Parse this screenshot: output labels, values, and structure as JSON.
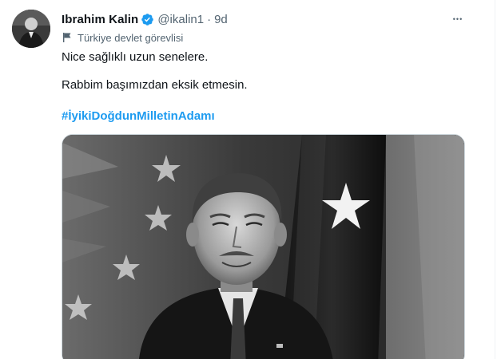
{
  "tweet": {
    "author_name": "Ibrahim Kalin",
    "verified_icon": "verified-badge-icon",
    "handle": "@ikalin1",
    "separator": "·",
    "time": "9d",
    "more_icon": "more-options-icon",
    "more_glyph": "•••",
    "label_icon": "flag-icon",
    "label": "Türkiye devlet görevlisi",
    "lines": [
      "Nice sağlıklı uzun senelere.",
      "Rabbim başımızdan eksik etmesin."
    ],
    "hashtag": "#İyikiDoğdunMilletinAdamı",
    "media_icon": "photo-media"
  },
  "colors": {
    "accent": "#1d9bf0",
    "secondary_text": "#536471",
    "verified": "#1d9bf0"
  }
}
